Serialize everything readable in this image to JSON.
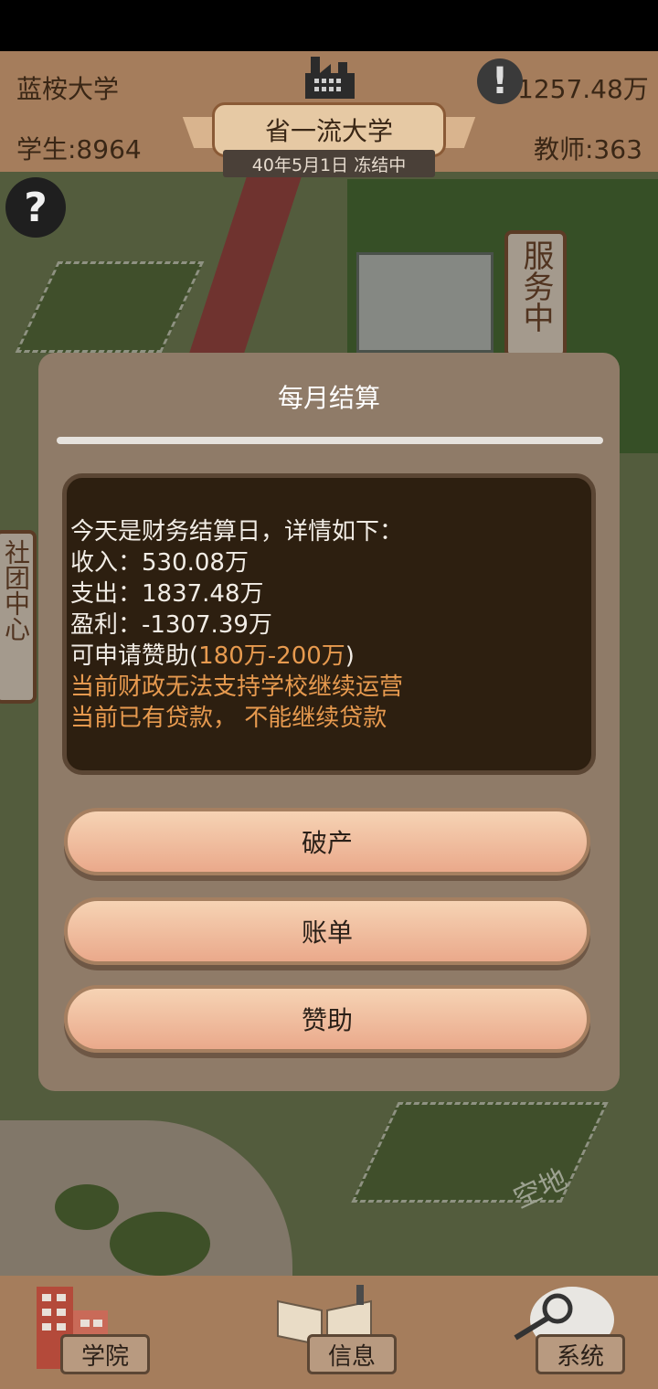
{
  "header": {
    "school_name": "蓝桉大学",
    "money": "1257.48万",
    "students": "学生:8964",
    "teachers": "教师:363",
    "rank_title": "省一流大学",
    "date_status": "40年5月1日 冻结中"
  },
  "map": {
    "service_sign": "服务中",
    "club_sign": "社团中心",
    "empty_lot_label": "空地"
  },
  "dialog": {
    "title": "每月结算",
    "message": {
      "line1": "今天是财务结算日，详情如下：",
      "income": "收入：530.08万",
      "expense": "支出：1837.48万",
      "profit": "盈利：-1307.39万",
      "sponsor_prefix": "可申请赞助(",
      "sponsor_range": "180万-200万",
      "sponsor_suffix": ")",
      "warning1": "当前财政无法支持学校继续运营",
      "warning2": "当前已有贷款， 不能继续贷款"
    },
    "buttons": {
      "bankrupt": "破产",
      "bill": "账单",
      "sponsor": "赞助"
    }
  },
  "bottom_nav": {
    "college": "学院",
    "info": "信息",
    "system": "系统"
  },
  "icons": {
    "help": "question-icon",
    "alert": "exclamation-icon",
    "factory": "factory-icon"
  }
}
